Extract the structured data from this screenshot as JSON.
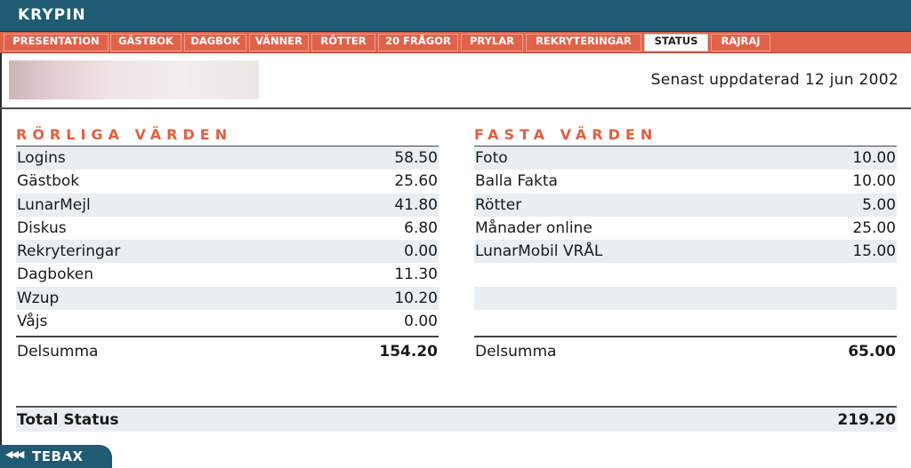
{
  "app": {
    "title": "KRYPIN"
  },
  "tabs": [
    {
      "label": "PRESENTATION",
      "active": false
    },
    {
      "label": "GÄSTBOK",
      "active": false
    },
    {
      "label": "DAGBOK",
      "active": false
    },
    {
      "label": "VÄNNER",
      "active": false
    },
    {
      "label": "RÖTTER",
      "active": false
    },
    {
      "label": "20 FRÅGOR",
      "active": false
    },
    {
      "label": "PRYLAR",
      "active": false
    },
    {
      "label": "REKRYTERINGAR",
      "active": false
    },
    {
      "label": "STATUS",
      "active": true
    },
    {
      "label": "RAJRAJ",
      "active": false
    }
  ],
  "header": {
    "updated": "Senast uppdaterad 12 jun 2002"
  },
  "left": {
    "heading": "RÖRLIGA VÄRDEN",
    "rows": [
      {
        "label": "Logins",
        "value": "58.50"
      },
      {
        "label": "Gästbok",
        "value": "25.60"
      },
      {
        "label": "LunarMejl",
        "value": "41.80"
      },
      {
        "label": "Diskus",
        "value": "6.80"
      },
      {
        "label": "Rekryteringar",
        "value": "0.00"
      },
      {
        "label": "Dagboken",
        "value": "11.30"
      },
      {
        "label": "Wzup",
        "value": "10.20"
      },
      {
        "label": "Våjs",
        "value": "0.00"
      }
    ],
    "subtotal_label": "Delsumma",
    "subtotal_value": "154.20"
  },
  "right": {
    "heading": "FASTA VÄRDEN",
    "rows": [
      {
        "label": "Foto",
        "value": "10.00"
      },
      {
        "label": "Balla Fakta",
        "value": "10.00"
      },
      {
        "label": "Rötter",
        "value": "5.00"
      },
      {
        "label": "Månader online",
        "value": "25.00"
      },
      {
        "label": "LunarMobil VRÅL",
        "value": "15.00"
      },
      {
        "label": "",
        "value": ""
      },
      {
        "label": "",
        "value": ""
      },
      {
        "label": "",
        "value": ""
      }
    ],
    "subtotal_label": "Delsumma",
    "subtotal_value": "65.00"
  },
  "total": {
    "label": "Total Status",
    "value": "219.20"
  },
  "back": {
    "arrows": "◀◀◀",
    "label": "TEBAX"
  },
  "colors": {
    "titlebar": "#1f5b73",
    "tabbar": "#e1624a",
    "heading": "#e0603f",
    "row_shade": "#e8eef1"
  }
}
